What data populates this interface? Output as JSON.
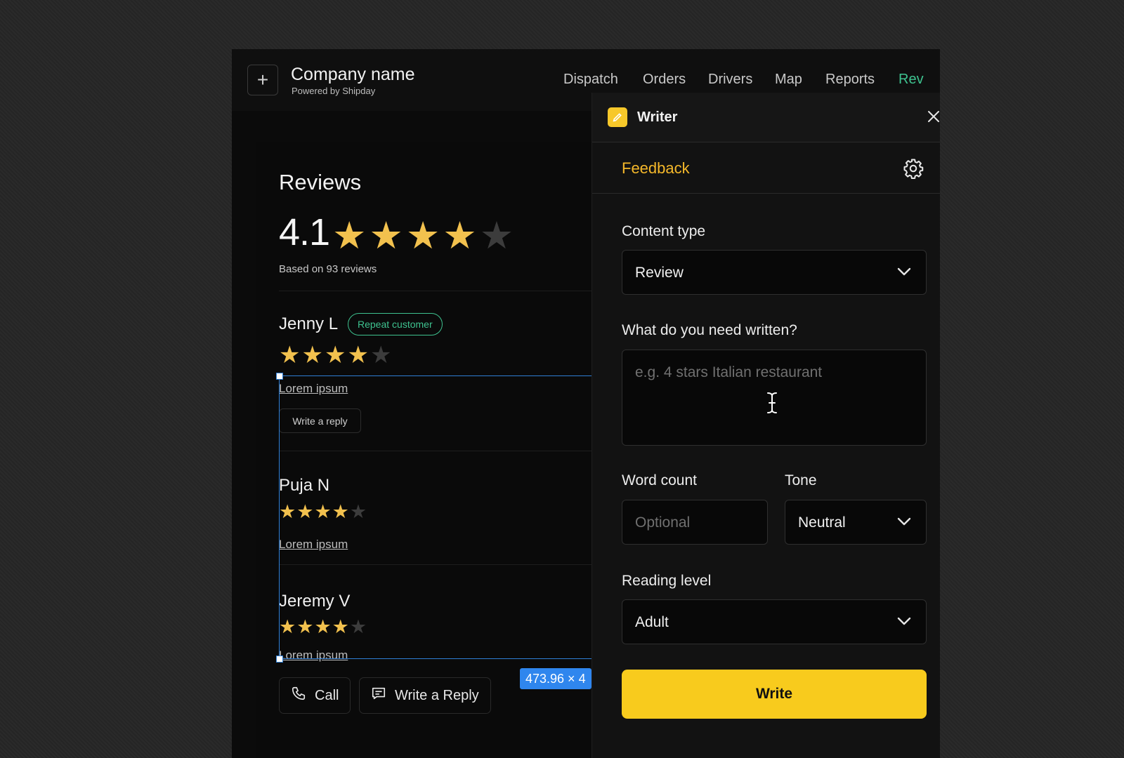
{
  "header": {
    "company_name": "Company name",
    "powered_by": "Powered by Shipday",
    "plus_icon": "plus-icon",
    "nav": [
      "Dispatch",
      "Orders",
      "Drivers",
      "Map",
      "Reports",
      "Rev"
    ],
    "active_nav": "Rev",
    "accent_color": "#3ec28f"
  },
  "reviews": {
    "title": "Reviews",
    "average": "4.1",
    "average_stars": 4,
    "based_on": "Based on 93 reviews",
    "items": [
      {
        "name": "Jenny L",
        "badge": "Repeat customer",
        "stars": 4,
        "text": "Lorem ipsum",
        "reply_label": "Write a reply"
      },
      {
        "name": "Puja N",
        "stars": 4,
        "text": "Lorem ipsum"
      },
      {
        "name": "Jeremy V",
        "stars": 4,
        "text": "Lorem ipsum"
      }
    ],
    "call_label": "Call",
    "write_reply_label": "Write a Reply",
    "dimension_tag": "473.96 × 4"
  },
  "writer": {
    "title": "Writer",
    "tab": "Feedback",
    "content_type_label": "Content type",
    "content_type_value": "Review",
    "prompt_label": "What do you need written?",
    "prompt_placeholder": "e.g. 4 stars Italian restaurant",
    "word_count_label": "Word count",
    "word_count_placeholder": "Optional",
    "tone_label": "Tone",
    "tone_value": "Neutral",
    "reading_level_label": "Reading level",
    "reading_level_value": "Adult",
    "write_button": "Write",
    "brand_color": "#f8cb1d",
    "feedback_color": "#f5b82a"
  }
}
